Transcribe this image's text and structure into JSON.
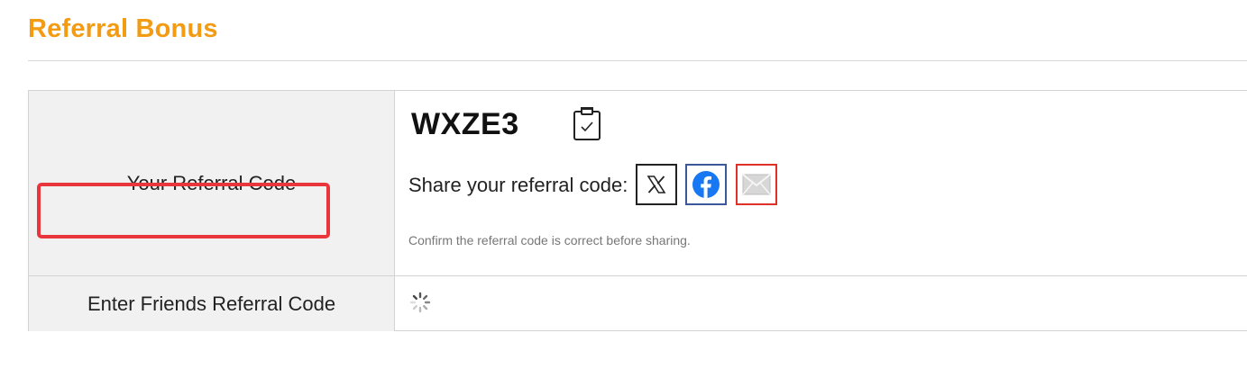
{
  "header": {
    "title": "Referral Bonus"
  },
  "referral": {
    "your_code_label": "Your Referral Code",
    "code": "WXZE3",
    "share_label": "Share your referral code:",
    "hint": "Confirm the referral code is correct before sharing.",
    "friends_code_label": "Enter Friends Referral Code"
  },
  "share_buttons": [
    {
      "name": "x",
      "icon": "x-logo-icon",
      "color": "#222222"
    },
    {
      "name": "facebook",
      "icon": "facebook-icon",
      "color": "#1877f2"
    },
    {
      "name": "email",
      "icon": "mail-icon",
      "color": "#e0302a"
    }
  ],
  "colors": {
    "title": "#f29b13",
    "label_bg": "#f1f1f1",
    "highlight": "#e8363c"
  }
}
